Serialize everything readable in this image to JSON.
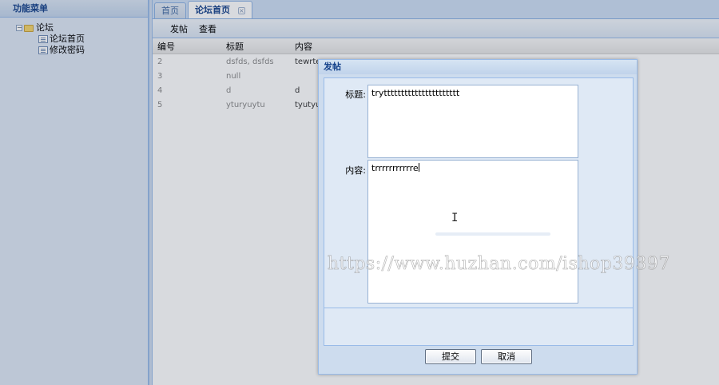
{
  "sidebar": {
    "title": "功能菜单",
    "root": {
      "label": "论坛",
      "expander": "−"
    },
    "items": [
      {
        "label": "论坛首页"
      },
      {
        "label": "修改密码"
      }
    ]
  },
  "tabs": [
    {
      "label": "首页",
      "active": false
    },
    {
      "label": "论坛首页",
      "active": true,
      "close": "×"
    }
  ],
  "toolbar": {
    "post_label": "发帖",
    "view_label": "查看"
  },
  "grid": {
    "columns": [
      "编号",
      "标题",
      "内容"
    ],
    "rows": [
      {
        "id": "2",
        "title": "dsfds, dsfds",
        "content": "tewrte"
      },
      {
        "id": "3",
        "title": "null",
        "content": ""
      },
      {
        "id": "4",
        "title": "d",
        "content": "d"
      },
      {
        "id": "5",
        "title": "yturyuytu",
        "content": "tyutyuy"
      }
    ]
  },
  "dialog": {
    "title": "发帖",
    "title_label": "标题:",
    "title_value": "trytttttttttttttttttttttt",
    "content_label": "内容:",
    "content_value": "trrrrrrrrrrre",
    "submit_label": "提交",
    "cancel_label": "取消"
  },
  "watermark": "https://www.huzhan.com/ishop39397",
  "colors": {
    "accent": "#15428b",
    "panel_bg": "#dfe8f6",
    "border": "#99bbe8"
  }
}
